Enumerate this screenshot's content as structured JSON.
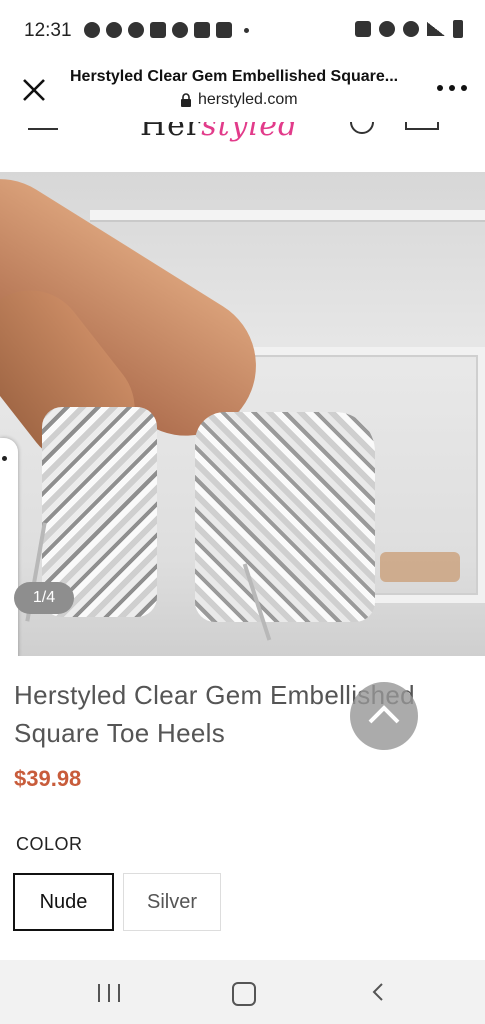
{
  "status_bar": {
    "time": "12:31"
  },
  "browser": {
    "page_title": "Herstyled Clear Gem Embellished Square...",
    "url": "herstyled.com"
  },
  "site": {
    "logo_part1": "Her",
    "logo_part2": "styled"
  },
  "product": {
    "image_counter": "1/4",
    "title": "Herstyled Clear Gem Embellished Square Toe Heels",
    "price": "$39.98",
    "color_label": "COLOR",
    "color_options": [
      "Nude",
      "Silver"
    ],
    "selected_color": "Nude"
  },
  "colors": {
    "price": "#c85c3b",
    "logo_accent": "#e23b8a"
  }
}
